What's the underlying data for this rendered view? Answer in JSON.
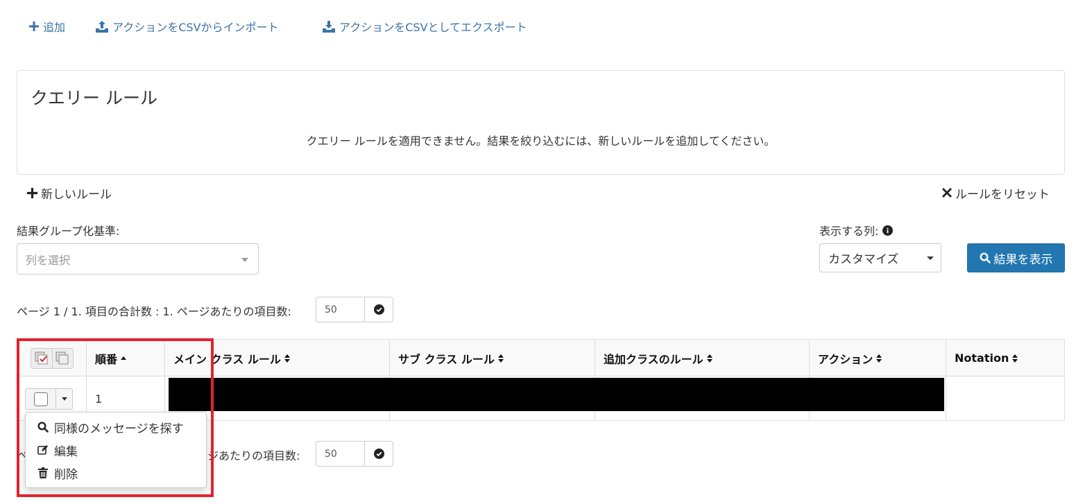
{
  "toolbar": {
    "add_label": "追加",
    "import_label": "アクションをCSVからインポート",
    "export_label": "アクションをCSVとしてエクスポート"
  },
  "query_panel": {
    "title": "クエリー ルール",
    "message": "クエリー ルールを適用できません。結果を絞り込むには、新しいルールを追加してください。"
  },
  "rules": {
    "new_rule_label": "新しいルール",
    "reset_label": "ルールをリセット"
  },
  "grouping": {
    "label": "結果グループ化基準:",
    "placeholder": "列を選択"
  },
  "columns_display": {
    "label": "表示する列:",
    "selected": "カスタマイズ"
  },
  "show_results_label": "結果を表示",
  "pager_top": {
    "text": "ページ 1 / 1. 項目の合計数 : 1. ページあたりの項目数:",
    "per_page": "50"
  },
  "pager_bottom": {
    "text_left": "ペ",
    "text_right": "ジあたりの項目数:",
    "per_page": "50"
  },
  "table": {
    "headers": [
      "順番",
      "メイン クラス ルール",
      "サブ クラス ルール",
      "追加クラスのルール",
      "アクション",
      "Notation"
    ],
    "rows": [
      {
        "order": "1"
      }
    ]
  },
  "row_menu": {
    "items": [
      "同様のメッセージを探す",
      "編集",
      "削除"
    ]
  },
  "colors": {
    "link": "#3a73a8",
    "primary_button": "#2277b0",
    "highlight": "#e3222b"
  }
}
